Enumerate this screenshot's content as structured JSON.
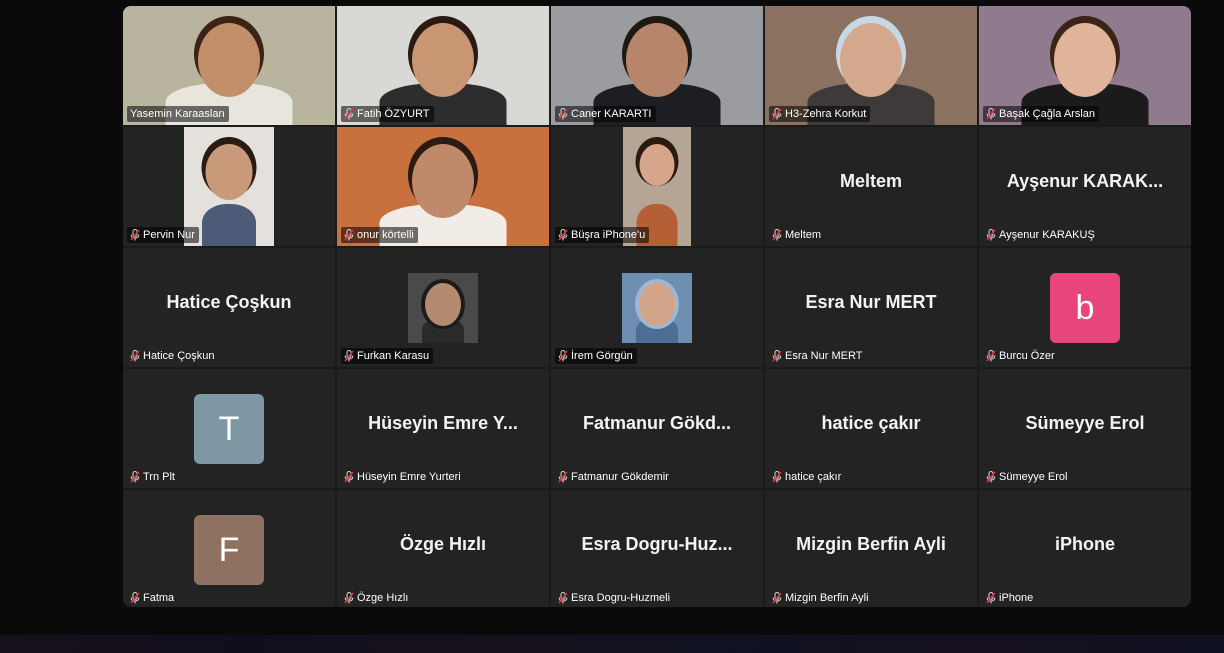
{
  "meeting": {
    "participants": [
      {
        "label": "Yasemin Karaaslan",
        "display": "",
        "kind": "video",
        "active": true,
        "muted": false,
        "bg": "#b8b49d",
        "skin": "#c38f6a",
        "hair": "#3b2416",
        "shirt": "#e8e5dd"
      },
      {
        "label": "Fatih ÖZYURT",
        "display": "",
        "kind": "video",
        "active": false,
        "muted": true,
        "bg": "#d8d8d4",
        "skin": "#c89672",
        "hair": "#2a1b12",
        "shirt": "#2d2d2d"
      },
      {
        "label": "Caner KARARTI",
        "display": "",
        "kind": "video",
        "active": false,
        "muted": true,
        "bg": "#9a9ca0",
        "skin": "#b7866a",
        "hair": "#1f1914",
        "shirt": "#1e1e22"
      },
      {
        "label": "H3-Zehra Korkut",
        "display": "",
        "kind": "video",
        "active": false,
        "muted": true,
        "bg": "#8a7160",
        "skin": "#d4a88c",
        "hair": "#c7d7e6",
        "shirt": "#3e3a3a"
      },
      {
        "label": "Başak Çağla Arslan",
        "display": "",
        "kind": "video",
        "active": false,
        "muted": true,
        "bg": "#8f7a8e",
        "skin": "#e0b49a",
        "hair": "#3a2418",
        "shirt": "#1b1b1b"
      },
      {
        "label": "Pervin Nur",
        "display": "",
        "kind": "video-narrow",
        "active": false,
        "muted": true,
        "bg": "#e4e1dc",
        "skin": "#c99a7a",
        "hair": "#2a1b12",
        "shirt": "#4d5b79"
      },
      {
        "label": "onur körtelli",
        "display": "",
        "kind": "video",
        "active": false,
        "muted": true,
        "bg": "#c9703f",
        "skin": "#c08a6a",
        "hair": "#2b1b12",
        "shirt": "#f1ece6"
      },
      {
        "label": "Büşra iPhone'u",
        "display": "",
        "kind": "video-narrow",
        "active": false,
        "muted": true,
        "bg": "#b5a594",
        "skin": "#d7a68a",
        "hair": "#2a1a12",
        "shirt": "#b45f36"
      },
      {
        "label": "Meltem",
        "display": "Meltem",
        "kind": "name",
        "active": false,
        "muted": true
      },
      {
        "label": "Ayşenur KARAKUŞ",
        "display": "Ayşenur  KARAK...",
        "kind": "name",
        "active": false,
        "muted": true
      },
      {
        "label": "Hatice Çoşkun",
        "display": "Hatice Çoşkun",
        "kind": "name",
        "active": false,
        "muted": true
      },
      {
        "label": "Furkan Karasu",
        "display": "",
        "kind": "thumb",
        "active": false,
        "muted": true,
        "bg": "#4a4a4a",
        "skin": "#b48a70",
        "hair": "#1b1b1b",
        "shirt": "#2a2a2a"
      },
      {
        "label": "İrem Görgün",
        "display": "",
        "kind": "thumb",
        "active": false,
        "muted": true,
        "bg": "#6e8fb2",
        "skin": "#d2a58a",
        "hair": "#9fb8d2",
        "shirt": "#4a6e95"
      },
      {
        "label": "Esra Nur MERT",
        "display": "Esra Nur MERT",
        "kind": "name",
        "active": false,
        "muted": true
      },
      {
        "label": "Burcu Özer",
        "display": "b",
        "kind": "avatar",
        "active": false,
        "muted": true,
        "color": "#e8457a"
      },
      {
        "label": "Trn Plt",
        "display": "T",
        "kind": "avatar",
        "active": false,
        "muted": true,
        "color": "#7d97a5"
      },
      {
        "label": "Hüseyin Emre Yurteri",
        "display": "Hüseyin  Emre  Y...",
        "kind": "name",
        "active": false,
        "muted": true
      },
      {
        "label": "Fatmanur Gökdemir",
        "display": "Fatmanur  Gökd...",
        "kind": "name",
        "active": false,
        "muted": true
      },
      {
        "label": "hatice çakır",
        "display": "hatice çakır",
        "kind": "name",
        "active": false,
        "muted": true
      },
      {
        "label": "Sümeyye Erol",
        "display": "Sümeyye Erol",
        "kind": "name",
        "active": false,
        "muted": true
      },
      {
        "label": "Fatma",
        "display": "F",
        "kind": "avatar",
        "active": false,
        "muted": true,
        "color": "#8e7161"
      },
      {
        "label": "Özge Hızlı",
        "display": "Özge Hızlı",
        "kind": "name",
        "active": false,
        "muted": true
      },
      {
        "label": "Esra Dogru-Huzmeli",
        "display": "Esra  Dogru-Huz...",
        "kind": "name",
        "active": false,
        "muted": true
      },
      {
        "label": "Mizgin Berfin Ayli",
        "display": "Mizgin Berfin Ayli",
        "kind": "name",
        "active": false,
        "muted": true
      },
      {
        "label": "iPhone",
        "display": "iPhone",
        "kind": "name",
        "active": false,
        "muted": true
      }
    ],
    "colors": {
      "active_border": "#23d96b",
      "muted_icon": "#e0333c",
      "tile_bg": "#232323",
      "gallery_bg": "#1a1a1a"
    },
    "icons": {
      "muted": "mic-muted-icon"
    }
  }
}
